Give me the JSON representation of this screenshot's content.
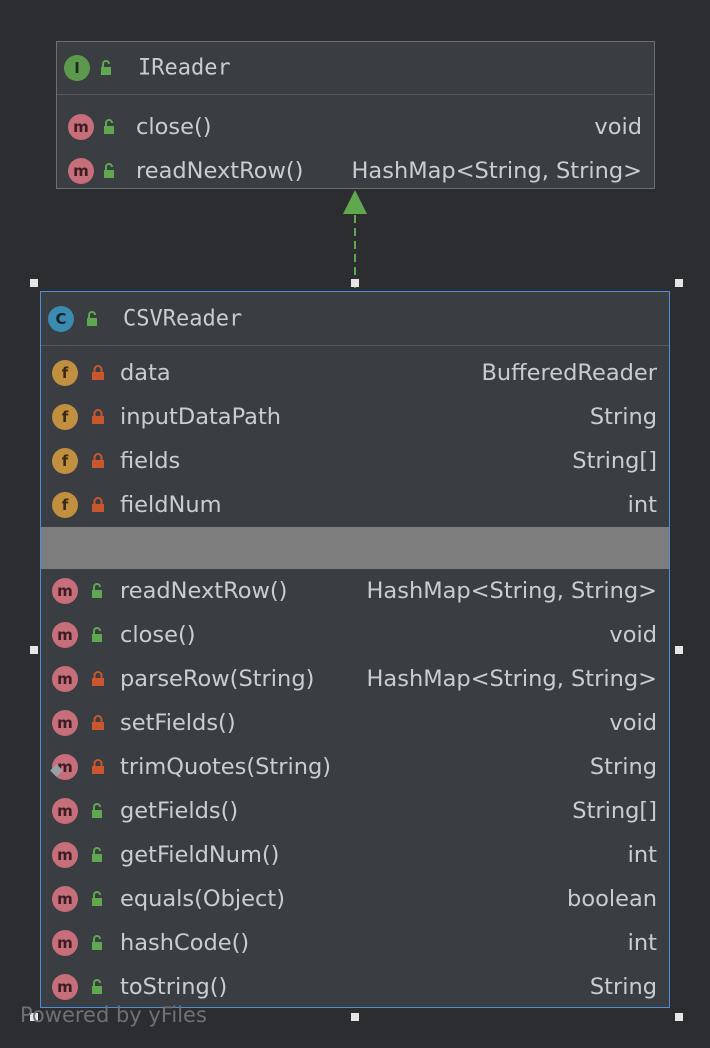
{
  "interface": {
    "badge": "I",
    "name": "IReader",
    "methods": [
      {
        "name": "close()",
        "type": "void"
      },
      {
        "name": "readNextRow()",
        "type": "HashMap<String, String>"
      }
    ]
  },
  "class": {
    "badge": "C",
    "name": "CSVReader",
    "fields": [
      {
        "name": "data",
        "type": "BufferedReader"
      },
      {
        "name": "inputDataPath",
        "type": "String"
      },
      {
        "name": "fields",
        "type": "String[]"
      },
      {
        "name": "fieldNum",
        "type": "int"
      }
    ],
    "methods": [
      {
        "name": "readNextRow()",
        "type": "HashMap<String, String>"
      },
      {
        "name": "close()",
        "type": "void"
      },
      {
        "name": "parseRow(String)",
        "type": "HashMap<String, String>"
      },
      {
        "name": "setFields()",
        "type": "void"
      },
      {
        "name": "trimQuotes(String)",
        "type": "String"
      },
      {
        "name": "getFields()",
        "type": "String[]"
      },
      {
        "name": "getFieldNum()",
        "type": "int"
      },
      {
        "name": "equals(Object)",
        "type": "boolean"
      },
      {
        "name": "hashCode()",
        "type": "int"
      },
      {
        "name": "toString()",
        "type": "String"
      }
    ]
  },
  "badges": {
    "field": "f",
    "method": "m"
  },
  "watermark": "Powered by yFiles",
  "colors": {
    "background": "#2b2d30",
    "node": "#3a3d41",
    "selection_border": "#4f8fda",
    "public_lock": "#5fa84f",
    "private_lock": "#c9572e",
    "arrow": "#5fa84f"
  }
}
